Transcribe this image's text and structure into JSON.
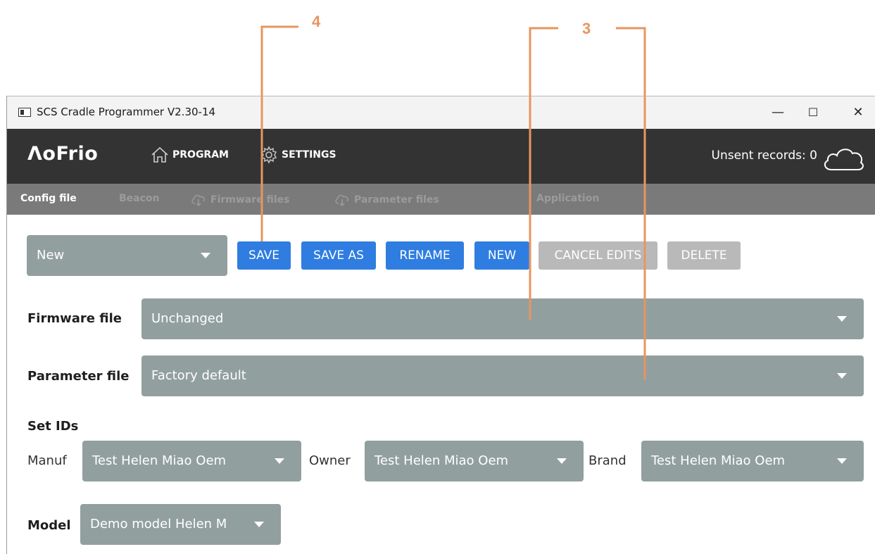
{
  "window": {
    "title": "SCS Cradle Programmer V2.30-14",
    "controls": {
      "minimize": "—",
      "maximize": "☐",
      "close": "✕"
    }
  },
  "navbar": {
    "logo": "ΛoFrio",
    "items": [
      {
        "label": "PROGRAM",
        "icon": "home-icon"
      },
      {
        "label": "SETTINGS",
        "icon": "gear-icon"
      }
    ],
    "unsent_label": "Unsent records: 0",
    "cloud_icon": "cloud-icon"
  },
  "subnav": {
    "items": [
      {
        "label": "Config file",
        "active": true
      },
      {
        "label": "Beacon",
        "active": false
      },
      {
        "label": "Firmware files",
        "active": false,
        "icon": "cloud-download-icon"
      },
      {
        "label": "Parameter files",
        "active": false,
        "icon": "cloud-download-icon"
      },
      {
        "label": "Application",
        "active": false
      }
    ]
  },
  "config": {
    "selected": "New",
    "buttons": {
      "save": "SAVE",
      "save_as": "SAVE AS",
      "rename": "RENAME",
      "new": "NEW",
      "cancel_edits": "CANCEL EDITS",
      "delete": "DELETE"
    }
  },
  "firmware": {
    "label": "Firmware file",
    "value": "Unchanged"
  },
  "parameter": {
    "label": "Parameter file",
    "value": "Factory default"
  },
  "set_ids": {
    "heading": "Set IDs",
    "manuf": {
      "label": "Manuf",
      "value": "Test Helen Miao Oem"
    },
    "owner": {
      "label": "Owner",
      "value": "Test Helen Miao Oem"
    },
    "brand": {
      "label": "Brand",
      "value": "Test Helen Miao Oem"
    }
  },
  "model": {
    "label": "Model",
    "value": "Demo model Helen M"
  },
  "callouts": {
    "save": "4",
    "dropdowns": "3"
  },
  "colors": {
    "accent_blue": "#2f7de1",
    "dropdown_grey": "#929f9f",
    "disabled_grey": "#b9b9b9",
    "callout_orange": "#e8955f",
    "navbar_dark": "#333333",
    "subnav_grey": "#7a7a7a"
  }
}
